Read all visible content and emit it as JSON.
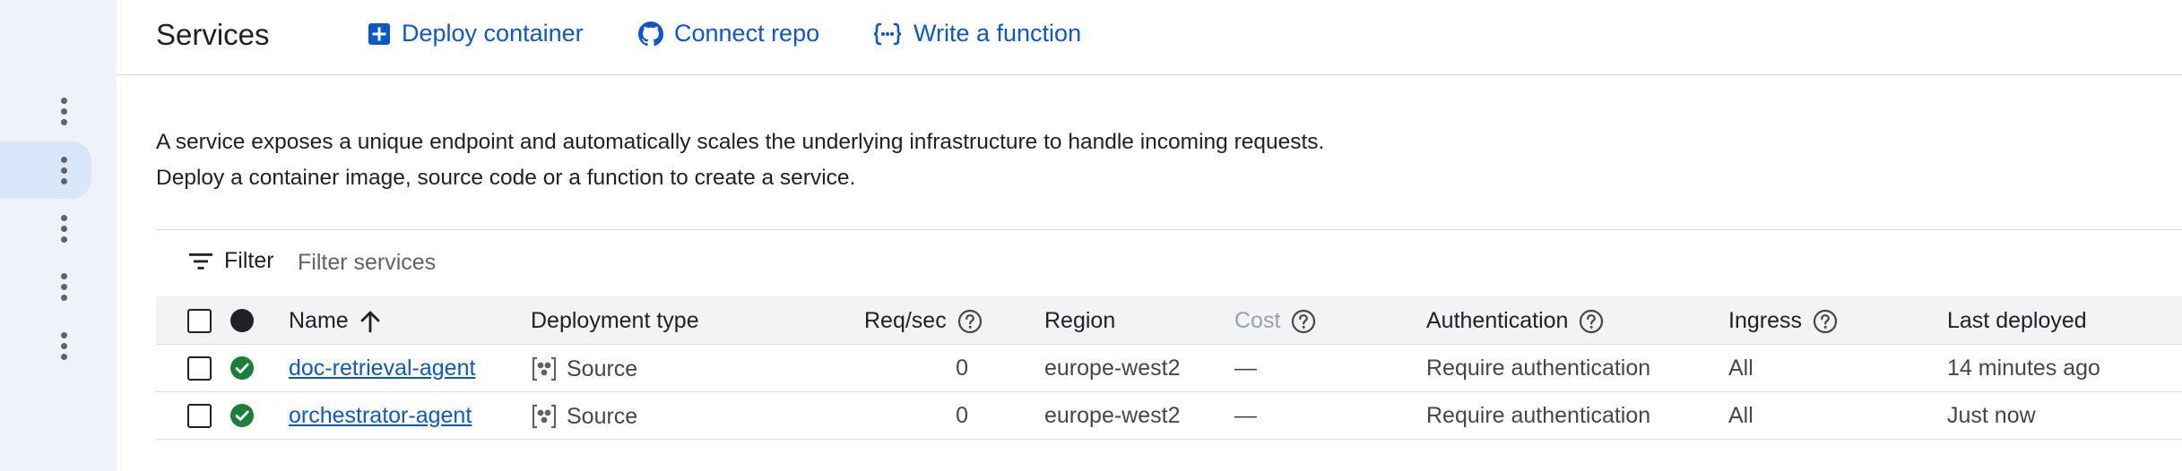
{
  "sidebar": {
    "items": [
      {
        "icon": "more-vert-icon",
        "active": false
      },
      {
        "icon": "more-vert-icon",
        "active": true
      },
      {
        "icon": "more-vert-icon",
        "active": false
      },
      {
        "icon": "more-vert-icon",
        "active": false
      },
      {
        "icon": "more-vert-icon",
        "active": false
      }
    ]
  },
  "header": {
    "title": "Services",
    "actions": [
      {
        "label": "Deploy container",
        "icon": "add-box-icon"
      },
      {
        "label": "Connect repo",
        "icon": "github-icon"
      },
      {
        "label": "Write a function",
        "icon": "function-braces-icon"
      }
    ]
  },
  "description": {
    "line1": "A service exposes a unique endpoint and automatically scales the underlying infrastructure to handle incoming requests.",
    "line2": "Deploy a container image, source code or a function to create a service."
  },
  "filter": {
    "label": "Filter",
    "placeholder": "Filter services"
  },
  "table": {
    "columns": {
      "name": "Name",
      "deployment_type": "Deployment type",
      "req_sec": "Req/sec",
      "region": "Region",
      "cost": "Cost",
      "authentication": "Authentication",
      "ingress": "Ingress",
      "last_deployed": "Last deployed"
    },
    "sort": {
      "column": "Name",
      "direction": "ascending"
    },
    "rows": [
      {
        "status": "ok",
        "name": "doc-retrieval-agent",
        "deployment_type": "Source",
        "req_sec": "0",
        "region": "europe-west2",
        "cost": "—",
        "authentication": "Require authentication",
        "ingress": "All",
        "last_deployed": "14 minutes ago"
      },
      {
        "status": "ok",
        "name": "orchestrator-agent",
        "deployment_type": "Source",
        "req_sec": "0",
        "region": "europe-west2",
        "cost": "—",
        "authentication": "Require authentication",
        "ingress": "All",
        "last_deployed": "Just now"
      }
    ]
  },
  "colors": {
    "accent": "#0b57d0",
    "success": "#188038",
    "rail_bg": "#eef2fa",
    "rail_active": "#d9e6f9",
    "table_header_bg": "#f1f3f4"
  }
}
